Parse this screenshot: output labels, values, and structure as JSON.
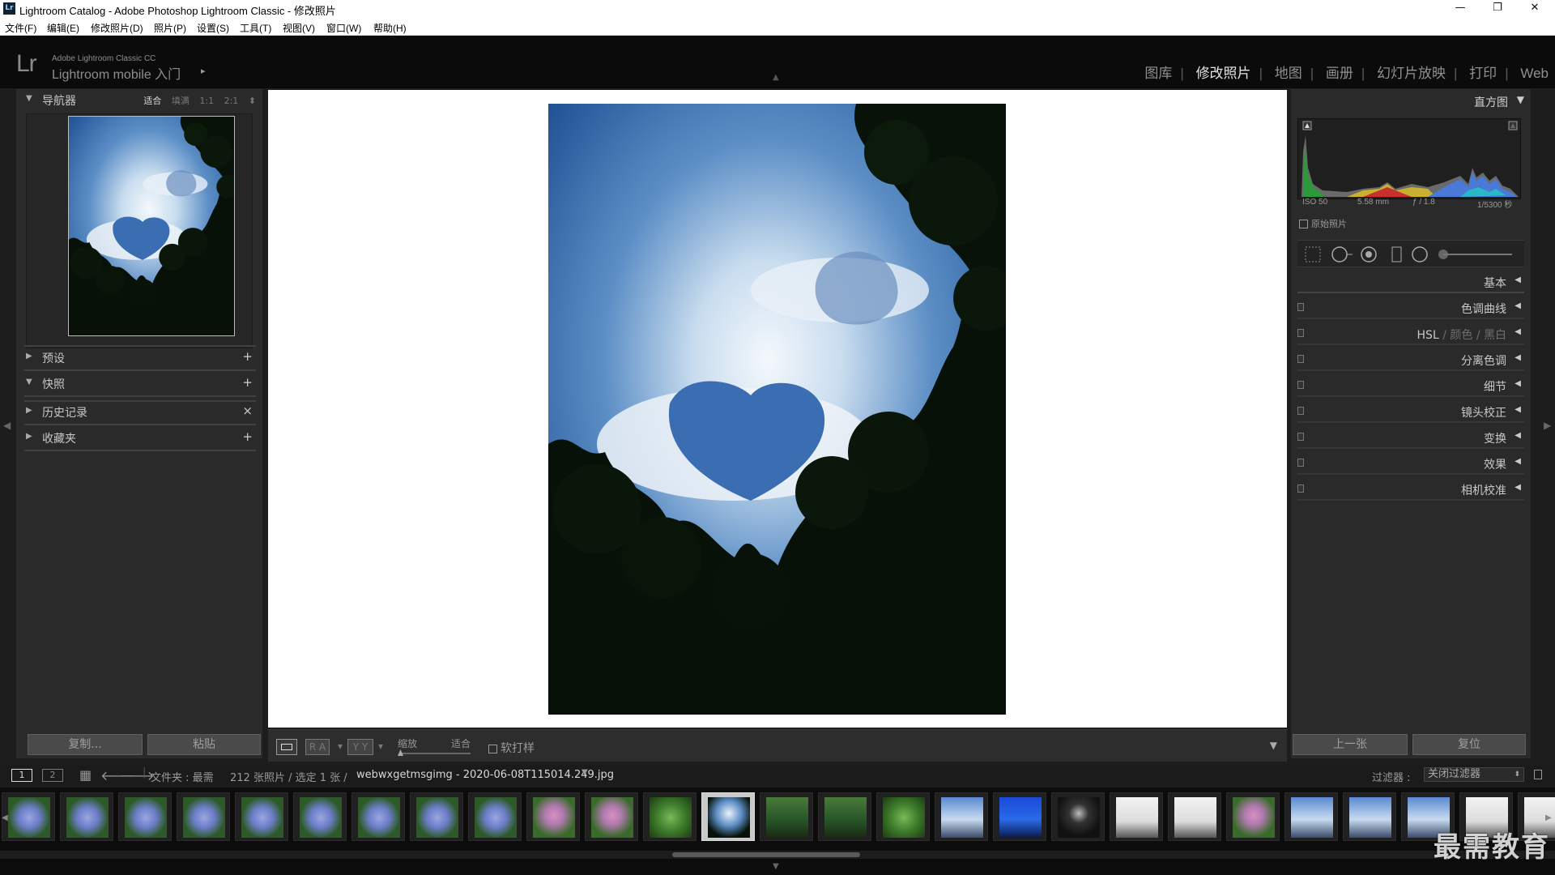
{
  "window": {
    "title": "Lightroom Catalog - Adobe Photoshop Lightroom Classic - 修改照片",
    "app_icon": "Lr",
    "controls": [
      "minimize-icon",
      "restore-icon",
      "close-icon"
    ]
  },
  "menu": [
    "文件(F)",
    "编辑(E)",
    "修改照片(D)",
    "照片(P)",
    "设置(S)",
    "工具(T)",
    "视图(V)",
    "窗口(W)",
    "帮助(H)"
  ],
  "identity": {
    "logo": "Lr",
    "line1": "Adobe Lightroom Classic CC",
    "line2": "Lightroom mobile 入门",
    "arrow": "▸"
  },
  "modules": [
    "图库",
    "修改照片",
    "地图",
    "画册",
    "幻灯片放映",
    "打印",
    "Web"
  ],
  "active_module": "修改照片",
  "left_panel": {
    "navigator": {
      "title": "导航器",
      "options": [
        "适合",
        "填满",
        "1:1",
        "2:1"
      ],
      "active_option": "适合"
    },
    "sections": [
      {
        "title": "预设",
        "action": "+"
      },
      {
        "title": "快照",
        "action": "+"
      },
      {
        "title": "历史记录",
        "action": "×"
      },
      {
        "title": "收藏夹",
        "action": "+"
      }
    ],
    "copy_button": "复制...",
    "paste_button": "粘贴"
  },
  "toolbar": {
    "zoom_label": "缩放",
    "zoom_value": "适合",
    "softproof_label": "软打样",
    "ra": "R A",
    "yy": "Y Y"
  },
  "right_panel": {
    "histogram_title": "直方图",
    "exif": [
      "ISO 50",
      "5.58 mm",
      "ƒ / 1.8",
      "1/5300 秒"
    ],
    "original_label": "原始照片",
    "sections": [
      {
        "title": "基本"
      },
      {
        "title": "色调曲线"
      },
      {
        "title": "HSL",
        "extras": [
          "颜色",
          "黑白"
        ]
      },
      {
        "title": "分离色调"
      },
      {
        "title": "细节"
      },
      {
        "title": "镜头校正"
      },
      {
        "title": "变换"
      },
      {
        "title": "效果"
      },
      {
        "title": "相机校准"
      }
    ],
    "prev_button": "上一张",
    "reset_button": "复位"
  },
  "filmstrip": {
    "pages": [
      "1",
      "2"
    ],
    "folder_label": "文件夹 : 最需",
    "count_label": "212 张照片 / 选定 1 张 /",
    "filename": "webwxgetmsgimg - 2020-06-08T115014.249.jpg",
    "filter_label": "过滤器 :",
    "filter_value": "关闭过滤器",
    "selected_index": 12,
    "thumbs": [
      "hydrangea",
      "hydrangea",
      "hydrangea",
      "hydrangea",
      "hydrangea",
      "hydrangea",
      "hydrangea",
      "hydrangea",
      "hydrangea",
      "flower",
      "flower",
      "leaves",
      "sky-heart",
      "forest",
      "forest",
      "leaves",
      "sky",
      "building",
      "night",
      "tree",
      "tree",
      "flower",
      "sky",
      "sky",
      "sky",
      "tree",
      "tree"
    ]
  },
  "watermark": "最需教育",
  "colors": {
    "accent": "#e4e4e4",
    "panel": "#2a2a2a",
    "background": "#1d1d1d"
  }
}
